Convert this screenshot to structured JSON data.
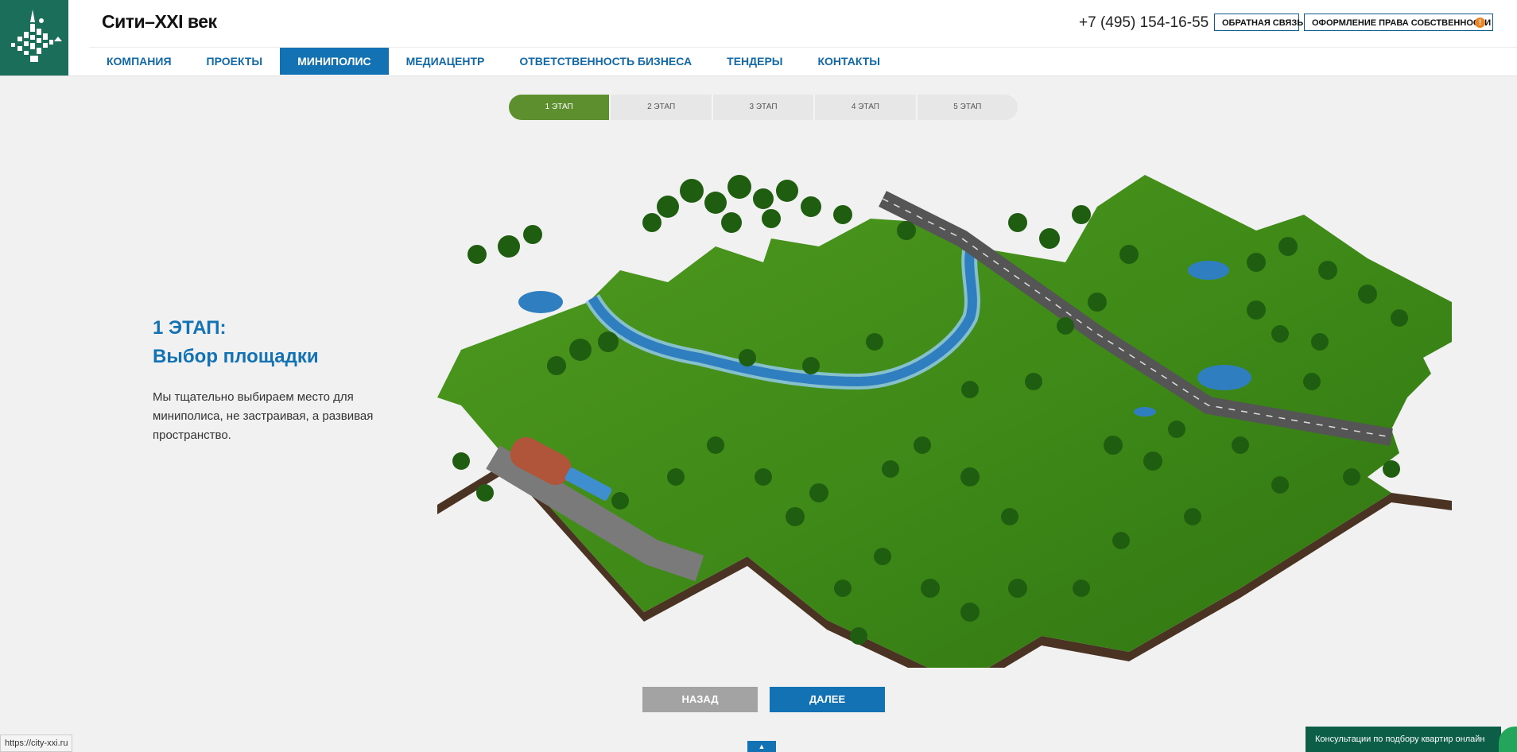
{
  "header": {
    "brand": "Сити–XXI век",
    "phone": "+7 (495) 154-16-55",
    "feedback_label": "ОБРАТНАЯ СВЯЗЬ",
    "ownership_label": "ОФОРМЛЕНИЕ ПРАВА СОБСТВЕННОСТИ",
    "ownership_badge": "!"
  },
  "nav": {
    "items": [
      {
        "label": "КОМПАНИЯ"
      },
      {
        "label": "ПРОЕКТЫ"
      },
      {
        "label": "МИНИПОЛИС",
        "active": true
      },
      {
        "label": "МЕДИАЦЕНТР"
      },
      {
        "label": "ОТВЕТСТВЕННОСТЬ БИЗНЕСА"
      },
      {
        "label": "ТЕНДЕРЫ"
      },
      {
        "label": "КОНТАКТЫ"
      }
    ]
  },
  "stages": [
    {
      "label": "1 ЭТАП",
      "active": true
    },
    {
      "label": "2 ЭТАП"
    },
    {
      "label": "3 ЭТАП"
    },
    {
      "label": "4 ЭТАП"
    },
    {
      "label": "5 ЭТАП"
    }
  ],
  "content": {
    "title": "1 ЭТАП:",
    "subtitle": "Выбор площадки",
    "description": "Мы тщательно выбираем место для миниполиса, не застраивая, а развивая пространство."
  },
  "buttons": {
    "back": "НАЗАД",
    "next": "ДАЛЕЕ"
  },
  "scroll_top_icon": "▲",
  "status_url": "https://city-xxi.ru",
  "consult_label": "Консультации по подбору квартир онлайн",
  "colors": {
    "brand_green": "#1b6e5a",
    "accent_blue": "#1372b4",
    "stage_active": "#5e8f2f",
    "badge_orange": "#e9862a"
  }
}
